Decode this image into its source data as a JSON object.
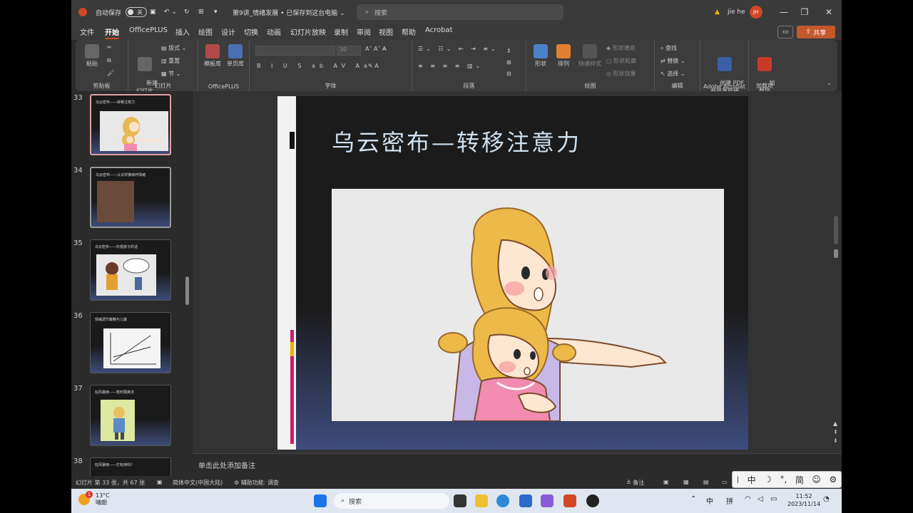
{
  "titlebar": {
    "autosave_label": "自动保存",
    "autosave_state": "关",
    "doc_title": "第9讲_情绪发展 • 已保存到这台电脑 ⌄",
    "search_placeholder": "搜索",
    "user_name": "jie he",
    "user_initials": "JH",
    "minimize": "—",
    "restore": "❐",
    "close": "✕"
  },
  "menu": {
    "items": [
      "文件",
      "开始",
      "OfficePLUS",
      "插入",
      "绘图",
      "设计",
      "切换",
      "动画",
      "幻灯片放映",
      "录制",
      "审阅",
      "视图",
      "帮助",
      "Acrobat"
    ],
    "active_index": 1,
    "share": "共享"
  },
  "ribbon": {
    "clipboard": {
      "paste": "粘贴",
      "group": "剪贴板"
    },
    "slides": {
      "new_slide": "新建\n幻灯片",
      "layout": "版式",
      "reset": "重置",
      "section": "节",
      "group": "幻灯片"
    },
    "officeplus": {
      "template": "模板库",
      "single_page": "单页库",
      "group": "OfficePLUS"
    },
    "font": {
      "size": "30",
      "group": "字体"
    },
    "paragraph": {
      "group": "段落"
    },
    "drawing": {
      "shape": "形状",
      "arrange": "排列",
      "quick_styles": "快速样式",
      "fill": "形状填充",
      "outline": "形状轮廓",
      "effects": "形状效果",
      "group": "绘图"
    },
    "editing": {
      "find": "查找",
      "replace": "替换",
      "select": "选择",
      "group": "编辑"
    },
    "acrobat": {
      "create_pdf": "创建 PDF\n并共享链接",
      "group": "Adobe Acrobat"
    },
    "addins": {
      "label": "加\n载项",
      "group": "加载项"
    }
  },
  "thumbnails": [
    {
      "number": "33",
      "title": "乌云密布——转移注意力"
    },
    {
      "number": "34",
      "title": "乌云密布——认识并接纳坏情绪"
    },
    {
      "number": "35",
      "title": "乌云密布——珍视孩子的话"
    },
    {
      "number": "36",
      "title": "情绪调节策略与儿童"
    },
    {
      "number": "37",
      "title": "狂风暴雨——暂时隔离法"
    },
    {
      "number": "38",
      "title": "狂风暴雨——打有用吗?"
    }
  ],
  "slide": {
    "title": "乌云密布—转移注意力"
  },
  "notes": {
    "placeholder": "单击此处添加备注"
  },
  "status": {
    "slide_info": "幻灯片 第 33 张，共 67 张",
    "language": "简体中文(中国大陆)",
    "accessibility": "辅助功能: 调查",
    "notes_btn": "备注"
  },
  "ime": [
    "中",
    "☽",
    "°,",
    "简",
    "☺",
    "⚙"
  ],
  "taskbar": {
    "temp": "13°C",
    "weather": "晴朗",
    "badge": "1",
    "search": "搜索",
    "tray_lang": "中",
    "tray_ime": "拼",
    "time": "11:52",
    "date": "2023/11/14"
  }
}
